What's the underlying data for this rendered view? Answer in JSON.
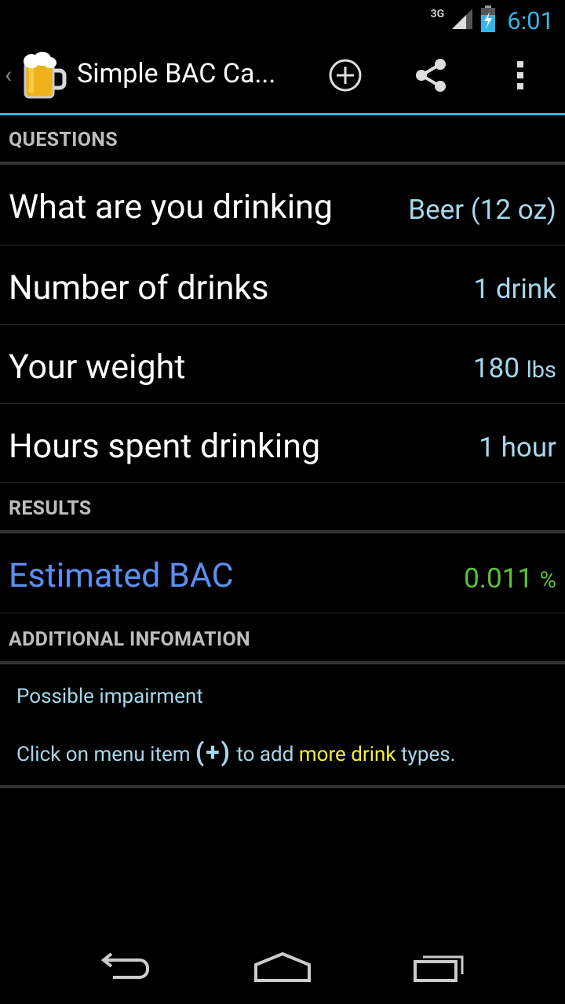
{
  "status_bar": {
    "network": "3G",
    "time": "6:01"
  },
  "action_bar": {
    "title": "Simple BAC Ca...",
    "app_icon": "beer-mug-icon",
    "accent_color": "#33b5e5",
    "actions": [
      {
        "icon": "add-icon"
      },
      {
        "icon": "share-icon"
      },
      {
        "icon": "overflow-menu-icon"
      }
    ]
  },
  "questions": {
    "header": "QUESTIONS",
    "rows": [
      {
        "label": "What are you drinking",
        "value": "Beer (12 oz)"
      },
      {
        "label": "Number of drinks",
        "value": "1 drink"
      },
      {
        "label": "Your weight",
        "value": "180",
        "unit": "lbs"
      },
      {
        "label": "Hours spent drinking",
        "value": "1 hour"
      }
    ]
  },
  "results": {
    "header": "RESULTS",
    "label": "Estimated BAC",
    "value": "0.011",
    "unit": "%",
    "label_color": "#5c8ff2",
    "value_color": "#5bc236"
  },
  "additional": {
    "header": "ADDITIONAL INFOMATION",
    "impairment": "Possible impairment",
    "tip_prefix": "Click on menu item",
    "tip_symbol": "(+)",
    "tip_mid": "to add",
    "tip_highlight": "more drink",
    "tip_suffix": "types.",
    "highlight_color": "#f7f12f"
  },
  "nav_bar": {
    "buttons": [
      {
        "icon": "back-icon"
      },
      {
        "icon": "home-icon"
      },
      {
        "icon": "recent-apps-icon"
      }
    ]
  }
}
